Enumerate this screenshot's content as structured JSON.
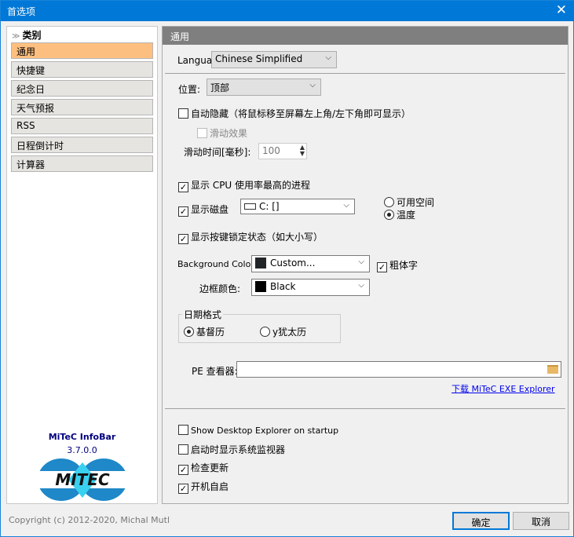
{
  "window": {
    "title": "首选项",
    "close": "✕"
  },
  "sidebar": {
    "header": "类别",
    "items": [
      {
        "label": "通用",
        "selected": true
      },
      {
        "label": "快捷键"
      },
      {
        "label": "纪念日"
      },
      {
        "label": "天气预报"
      },
      {
        "label": "RSS"
      },
      {
        "label": "日程倒计时"
      },
      {
        "label": "计算器"
      }
    ],
    "product": "MiTeC InfoBar",
    "version": "3.7.0.0",
    "logo_text": "MITEC"
  },
  "panel": {
    "title": "通用",
    "language_label": "Language:",
    "language_value": "Chinese Simplified",
    "position_label": "位置:",
    "position_value": "顶部",
    "autohide_label": "自动隐藏（将鼠标移至屏幕左上角/左下角即可显示）",
    "autohide_checked": false,
    "slide_effect_label": "滑动效果",
    "slide_effect_checked": false,
    "slide_time_label": "滑动时间[毫秒]:",
    "slide_time_value": "100",
    "show_cpu_label": "显示 CPU 使用率最高的进程",
    "show_cpu_checked": true,
    "show_disk_label": "显示磁盘",
    "show_disk_checked": true,
    "disk_value": "C: []",
    "radio_free_space": "可用空间",
    "radio_temperature": "温度",
    "disk_mode_selected": "温度",
    "show_lock_label": "显示按键锁定状态（如大小写）",
    "show_lock_checked": true,
    "bg_color_label": "Background Color:",
    "bg_color_value": "Custom...",
    "bg_color_hex": "#222629",
    "bold_label": "粗体字",
    "bold_checked": true,
    "border_color_label": "边框颜色:",
    "border_color_value": "Black",
    "border_color_hex": "#000000",
    "date_format_title": "日期格式",
    "date_gregorian": "基督历",
    "date_jewish": "y犹太历",
    "date_selected": "基督历",
    "pe_viewer_label": "PE 查看器:",
    "pe_viewer_value": "",
    "download_link": "下载 MiTeC EXE Explorer",
    "show_desktop_explorer": "Show Desktop Explorer on startup",
    "show_desktop_explorer_checked": false,
    "show_monitor": "启动时显示系统监视器",
    "show_monitor_checked": false,
    "check_updates": "检查更新",
    "check_updates_checked": true,
    "autostart": "开机自启",
    "autostart_checked": true
  },
  "footer": {
    "copyright": "Copyright (c) 2012-2020, Michal Mutl",
    "ok": "确定",
    "cancel": "取消"
  },
  "colors": {
    "titlebar": "#0078d7",
    "selected_item": "#fdbf80",
    "panel_header": "#7f7f7f",
    "link": "#0000ee"
  }
}
